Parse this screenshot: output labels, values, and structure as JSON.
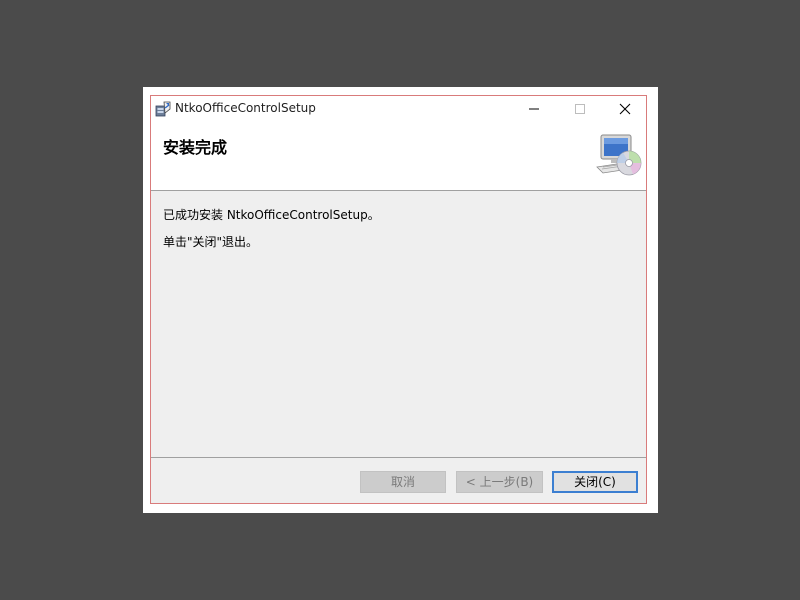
{
  "window": {
    "title": "NtkoOfficeControlSetup",
    "app_icon": "installer-icon",
    "controls": {
      "minimize_icon": "minimize-icon",
      "maximize_icon": "maximize-icon",
      "close_icon": "close-icon"
    }
  },
  "header": {
    "title": "安装完成",
    "image": "computer-cd-icon"
  },
  "body": {
    "line1": "已成功安装 NtkoOfficeControlSetup。",
    "line2": "单击\"关闭\"退出。"
  },
  "footer": {
    "cancel_label": "取消",
    "back_label": "< 上一步(B)",
    "close_label": "关闭(C)"
  },
  "colors": {
    "window_border": "#d97b7b",
    "focus_border": "#3c7fd1",
    "disabled_button": "#cccccc"
  }
}
